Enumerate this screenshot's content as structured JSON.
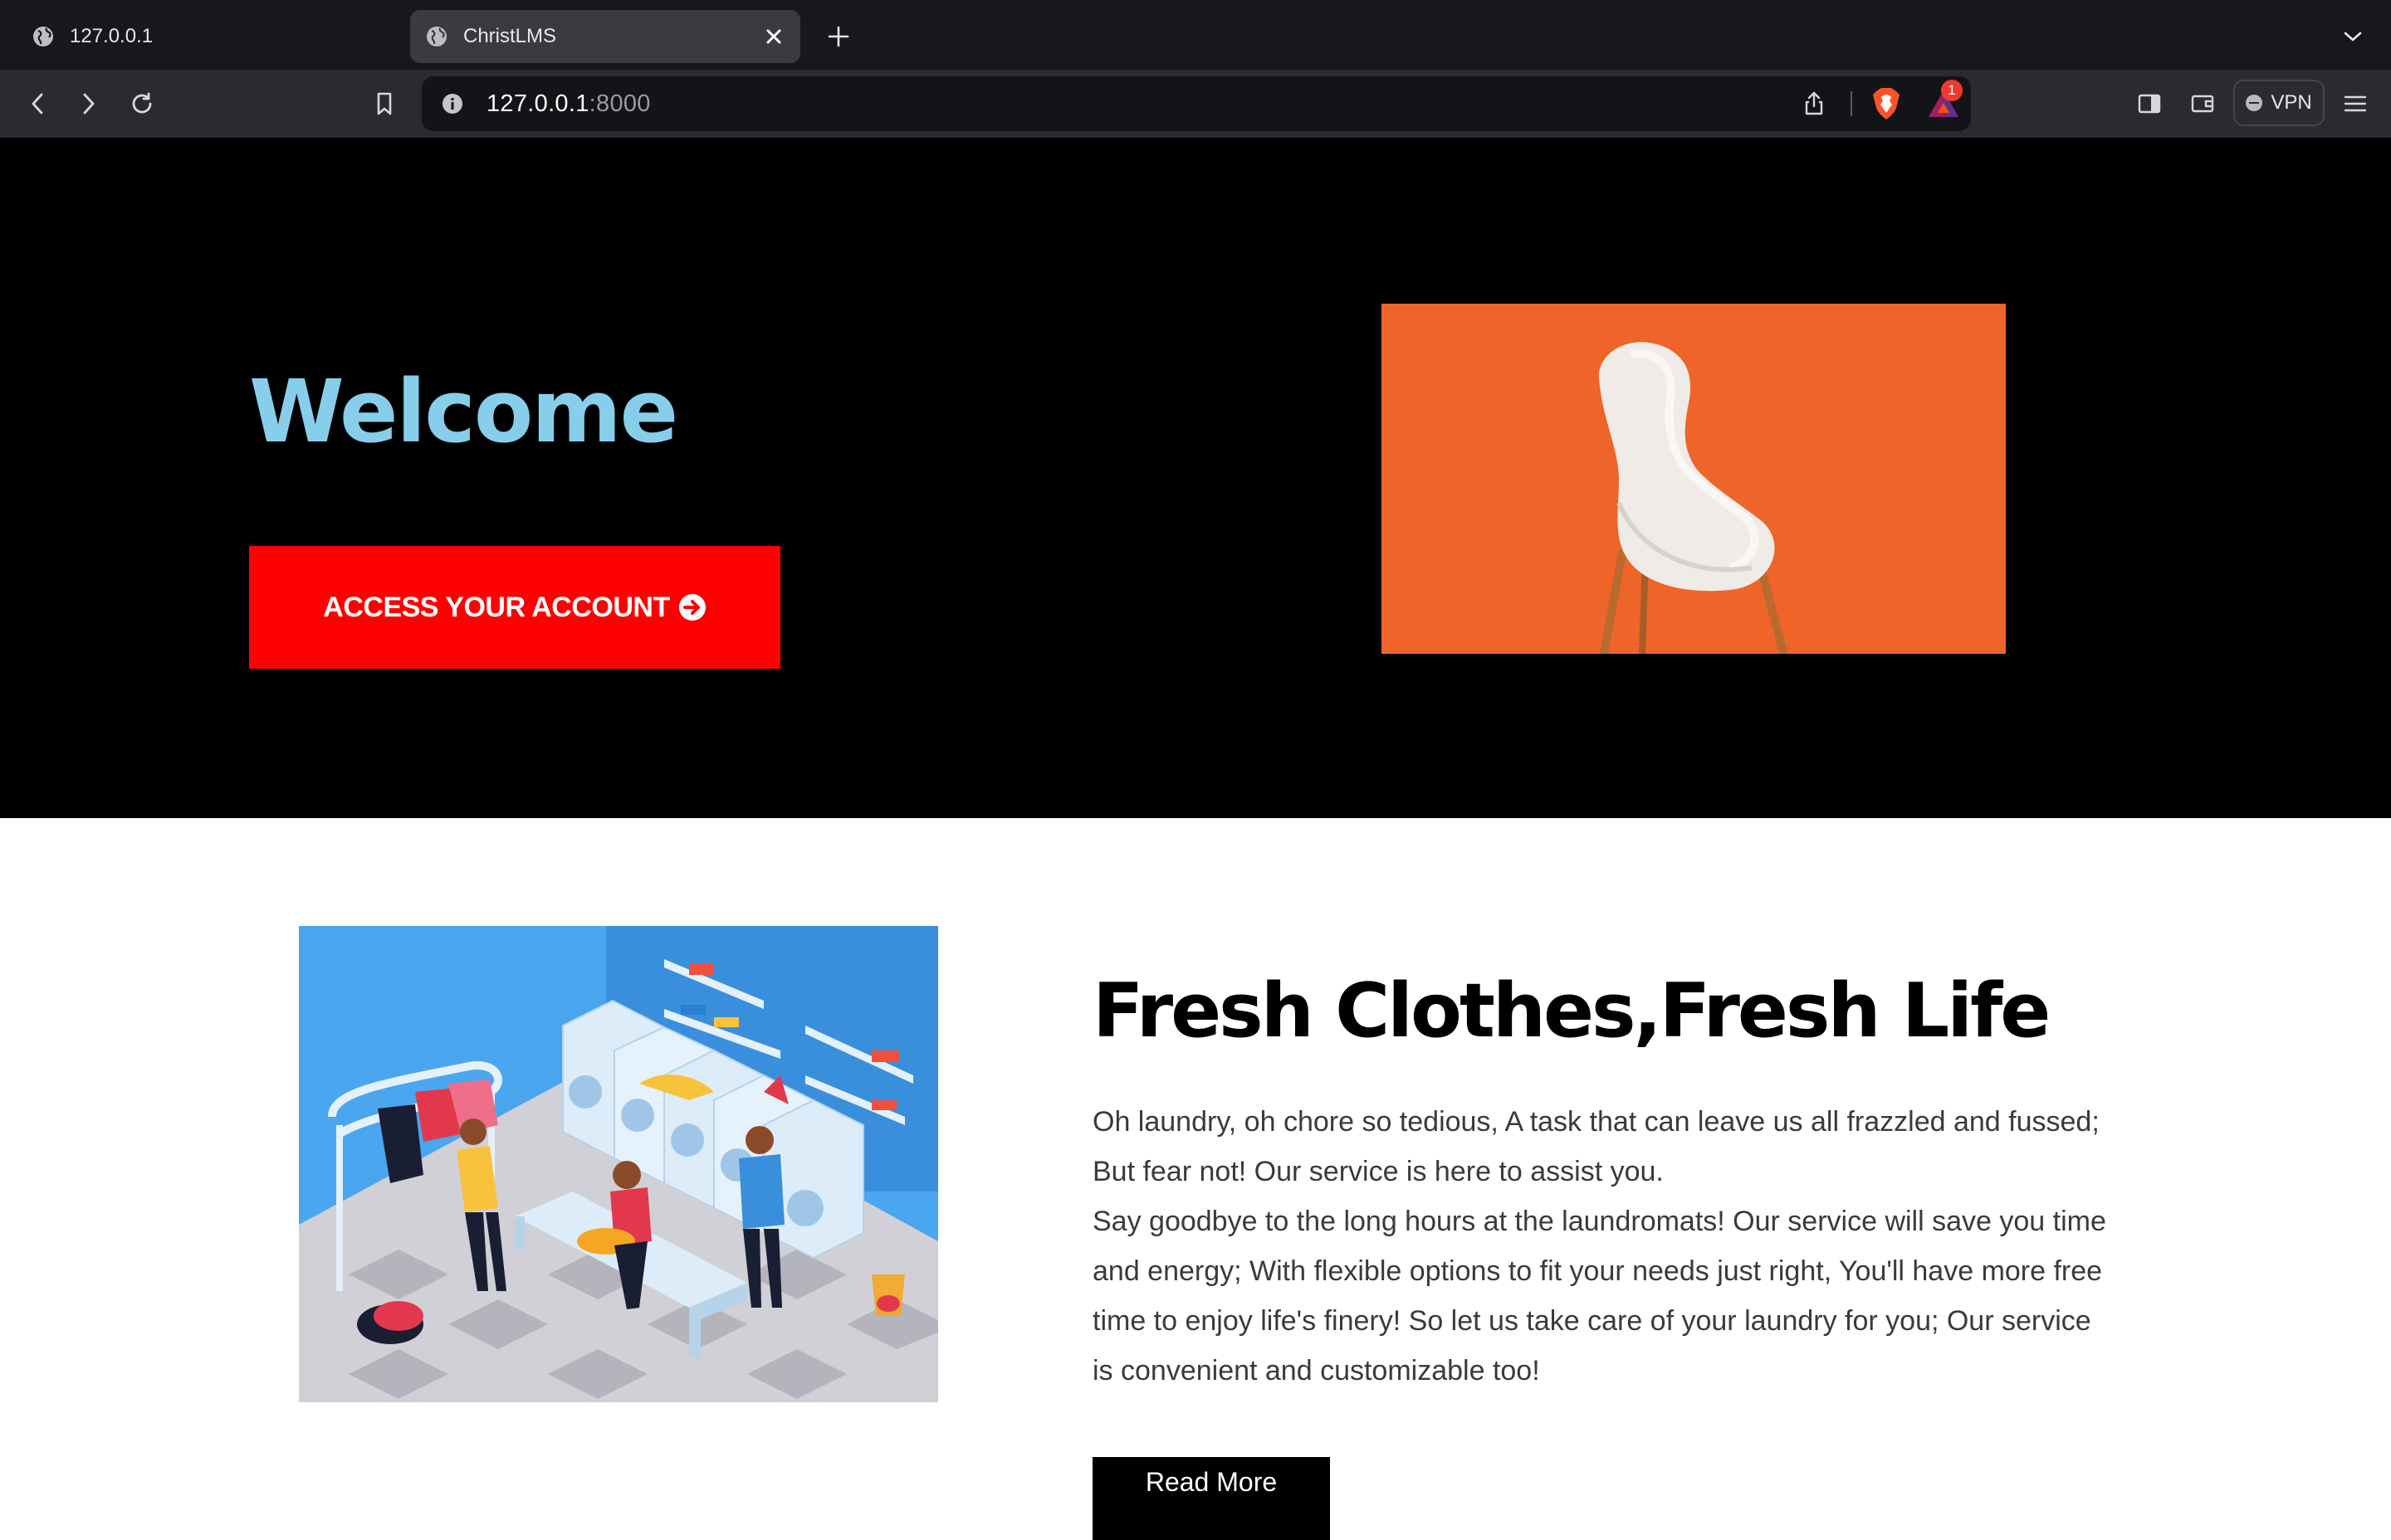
{
  "browser": {
    "tabs": [
      {
        "title": "127.0.0.1",
        "active": false
      },
      {
        "title": "ChristLMS",
        "active": true
      }
    ],
    "url_host": "127.0.0.1",
    "url_port": ":8000",
    "vpn_label": "VPN",
    "rewards_badge": "1"
  },
  "hero": {
    "title": "Welcome",
    "cta_label": "ACCESS YOUR ACCOUNT",
    "title_color": "#87ceeb",
    "cta_color": "#ff0000",
    "image_alt": "white chair on orange background"
  },
  "about": {
    "heading": "Fresh Clothes,Fresh Life",
    "paragraph_1": "Oh laundry, oh chore so tedious, A task that can leave us all frazzled and fussed; But fear not! Our service is here to assist you.",
    "paragraph_2": "Say goodbye to the long hours at the laundromats! Our service will save you time and energy; With flexible options to fit your needs just right, You'll have more free time to enjoy life's finery! So let us take care of your laundry for you; Our service is convenient and customizable too!",
    "button_label": "Read More",
    "image_alt": "laundromat illustration"
  }
}
